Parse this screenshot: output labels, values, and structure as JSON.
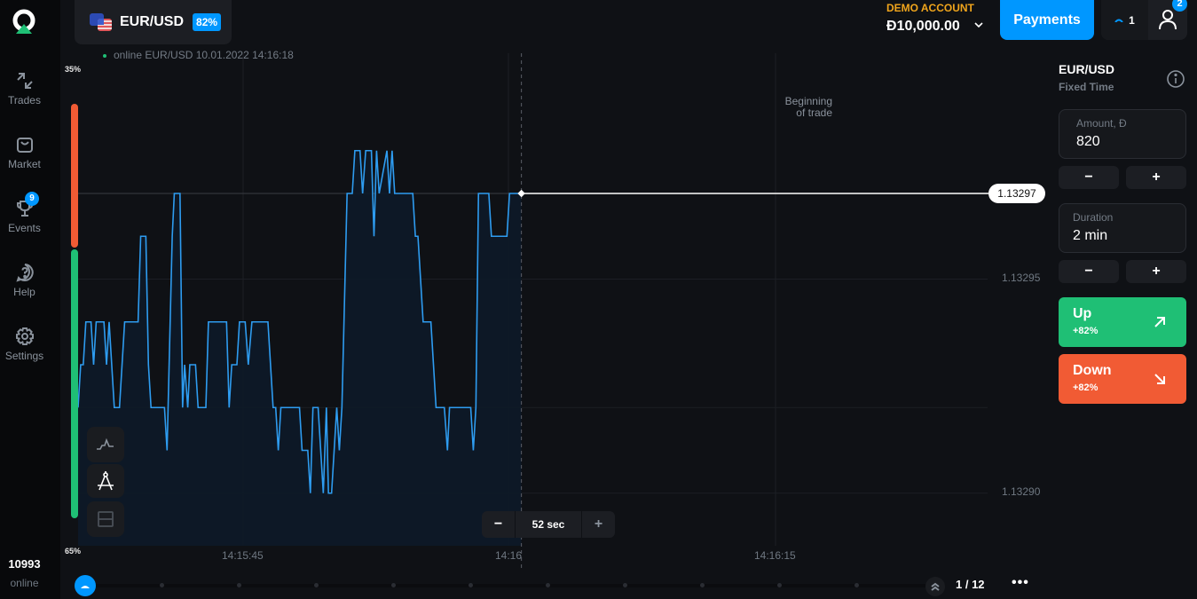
{
  "sidebar": {
    "items": [
      {
        "label": "Trades",
        "icon": "trades-arrows-icon"
      },
      {
        "label": "Market",
        "icon": "shopping-bag-icon"
      },
      {
        "label": "Events",
        "icon": "trophy-icon",
        "badge": "9"
      },
      {
        "label": "Help",
        "icon": "help-question-icon"
      },
      {
        "label": "Settings",
        "icon": "gear-icon"
      }
    ],
    "online_count": "10993",
    "online_label": "online"
  },
  "header": {
    "asset": "EUR/USD",
    "asset_payout": "82%",
    "live_info": "online EUR/USD  10.01.2022 14:16:18",
    "account_type": "DEMO ACCOUNT",
    "balance": "Đ10,000.00",
    "payments_label": "Payments",
    "open_trades": "1",
    "notifications": "2"
  },
  "chart": {
    "sentiment_top": "35%",
    "sentiment_bottom": "65%",
    "sentiment_up_fraction": 0.65,
    "current_price": "1.13297",
    "trade_start_label_1": "Beginning",
    "trade_start_label_2": "of trade",
    "zoom_value": "52 sec",
    "timeline_page": "1 / 12",
    "colors": {
      "line": "#2e9cf0",
      "up": "#1fbf75",
      "down": "#f15b34",
      "accent": "#0097ff"
    }
  },
  "chart_data": {
    "type": "line",
    "title": "EUR/USD",
    "xlabel": "",
    "ylabel": "",
    "x_ticks": [
      "14:15:45",
      "14:16",
      "14:16:15"
    ],
    "y_ticks": [
      "1.13295",
      "1.13290"
    ],
    "ylim": [
      1.132886,
      1.132992
    ],
    "grid": true,
    "series": [
      {
        "name": "EUR/USD",
        "t_seconds": [
          0,
          0.5,
          1,
          1.5,
          2.5,
          3,
          3.5,
          5,
          5.5,
          6,
          7,
          8,
          9,
          11.6,
          12.1,
          13.1,
          13.6,
          14.1,
          16.7,
          17.2,
          18.2,
          18.6,
          19.7,
          20.2,
          20.6,
          21.2,
          21.6,
          22.7,
          23.2,
          24.7,
          25.2,
          28.7,
          29.2,
          29.7,
          30.7,
          31.2,
          32.3,
          32.9,
          33.6,
          36.7,
          37.7,
          38.2,
          38.7,
          39.2,
          39.7,
          42.8,
          43.3,
          44.4,
          44.9,
          45.4,
          46.4,
          47.4,
          48,
          48.4,
          49,
          50,
          50.5,
          51,
          52,
          53,
          53.5,
          54.5,
          55,
          55.6,
          56.7,
          57.2,
          57.7,
          58.2,
          59.7,
          60.2,
          60.7,
          61.2,
          64.7,
          65.2,
          65.7,
          66.7,
          68.2,
          69.2,
          70.8,
          71.4,
          71.8,
          75.9,
          76.4,
          76.9,
          77.4,
          79.4,
          79.9,
          82.9,
          83.4,
          85.7
        ],
        "values": [
          1.13292,
          1.13293,
          1.13293,
          1.13294,
          1.13294,
          1.13293,
          1.13294,
          1.13294,
          1.13293,
          1.13294,
          1.13292,
          1.13292,
          1.13294,
          1.13294,
          1.13296,
          1.13296,
          1.13293,
          1.13292,
          1.13292,
          1.13291,
          1.13296,
          1.13297,
          1.13297,
          1.13292,
          1.13293,
          1.13292,
          1.13293,
          1.13293,
          1.13292,
          1.13292,
          1.13294,
          1.13294,
          1.13292,
          1.13293,
          1.13293,
          1.13294,
          1.13294,
          1.13293,
          1.13294,
          1.13294,
          1.13292,
          1.13292,
          1.13291,
          1.13292,
          1.13292,
          1.13292,
          1.13291,
          1.13291,
          1.1329,
          1.13292,
          1.13292,
          1.1329,
          1.13292,
          1.1329,
          1.1329,
          1.13292,
          1.13291,
          1.13292,
          1.13297,
          1.13297,
          1.13298,
          1.13298,
          1.13297,
          1.13298,
          1.13298,
          1.13296,
          1.13298,
          1.13297,
          1.13298,
          1.13297,
          1.13298,
          1.13297,
          1.13297,
          1.13296,
          1.13296,
          1.13294,
          1.13294,
          1.13292,
          1.13292,
          1.13291,
          1.13292,
          1.13292,
          1.13291,
          1.13292,
          1.13297,
          1.13297,
          1.13296,
          1.13296,
          1.13297,
          1.13297
        ]
      }
    ],
    "trade_start_t_seconds": 85.7,
    "current_value": 1.13297
  },
  "panel": {
    "asset": "EUR/USD",
    "mode": "Fixed Time",
    "amount_label": "Amount, Đ",
    "amount_value": "820",
    "duration_label": "Duration",
    "duration_value": "2 min",
    "minus": "−",
    "plus": "+",
    "up_label": "Up",
    "up_payout": "+82%",
    "down_label": "Down",
    "down_payout": "+82%"
  }
}
